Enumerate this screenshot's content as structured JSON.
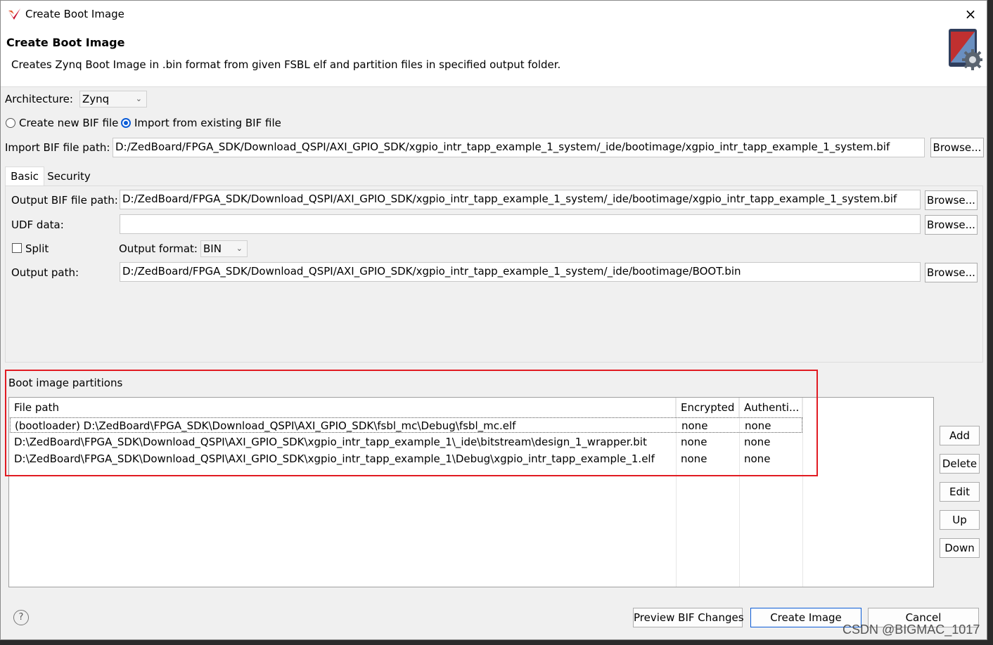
{
  "window": {
    "title": "Create Boot Image",
    "close_glyph": "×"
  },
  "header": {
    "title": "Create Boot Image",
    "description": "Creates Zynq Boot Image in .bin format from given FSBL elf and partition files in specified output folder."
  },
  "architecture": {
    "label": "Architecture:",
    "value": "Zynq"
  },
  "bif_mode": {
    "create_label": "Create new BIF file",
    "import_label": "Import from existing BIF file",
    "selected": "import"
  },
  "import_bif": {
    "label": "Import BIF file path:",
    "value": "D:/ZedBoard/FPGA_SDK/Download_QSPI/AXI_GPIO_SDK/xgpio_intr_tapp_example_1_system/_ide/bootimage/xgpio_intr_tapp_example_1_system.bif",
    "browse": "Browse..."
  },
  "tabs": [
    "Basic",
    "Security"
  ],
  "basic": {
    "output_bif_label": "Output BIF file path:",
    "output_bif_value": "D:/ZedBoard/FPGA_SDK/Download_QSPI/AXI_GPIO_SDK/xgpio_intr_tapp_example_1_system/_ide/bootimage/xgpio_intr_tapp_example_1_system.bif",
    "udf_label": "UDF data:",
    "udf_value": "",
    "split_label": "Split",
    "output_format_label": "Output format:",
    "output_format_value": "BIN",
    "output_path_label": "Output path:",
    "output_path_value": "D:/ZedBoard/FPGA_SDK/Download_QSPI/AXI_GPIO_SDK/xgpio_intr_tapp_example_1_system/_ide/bootimage/BOOT.bin",
    "browse": "Browse..."
  },
  "partitions": {
    "label": "Boot image partitions",
    "columns": [
      "File path",
      "Encrypted",
      "Authenti..."
    ],
    "rows": [
      [
        "(bootloader) D:\\ZedBoard\\FPGA_SDK\\Download_QSPI\\AXI_GPIO_SDK\\fsbl_mc\\Debug\\fsbl_mc.elf",
        "none",
        "none"
      ],
      [
        "D:\\ZedBoard\\FPGA_SDK\\Download_QSPI\\AXI_GPIO_SDK\\xgpio_intr_tapp_example_1\\_ide\\bitstream\\design_1_wrapper.bit",
        "none",
        "none"
      ],
      [
        "D:\\ZedBoard\\FPGA_SDK\\Download_QSPI\\AXI_GPIO_SDK\\xgpio_intr_tapp_example_1\\Debug\\xgpio_intr_tapp_example_1.elf",
        "none",
        "none"
      ]
    ],
    "buttons": {
      "add": "Add",
      "delete": "Delete",
      "edit": "Edit",
      "up": "Up",
      "down": "Down"
    }
  },
  "footer": {
    "help_glyph": "?",
    "preview": "Preview BIF Changes",
    "create": "Create Image",
    "cancel": "Cancel"
  },
  "watermark": "CSDN @BIGMAC_1017",
  "colors": {
    "accent": "#0b5cd7",
    "highlight_box": "#e11b22",
    "dialog_bg": "#f0f0f0"
  }
}
